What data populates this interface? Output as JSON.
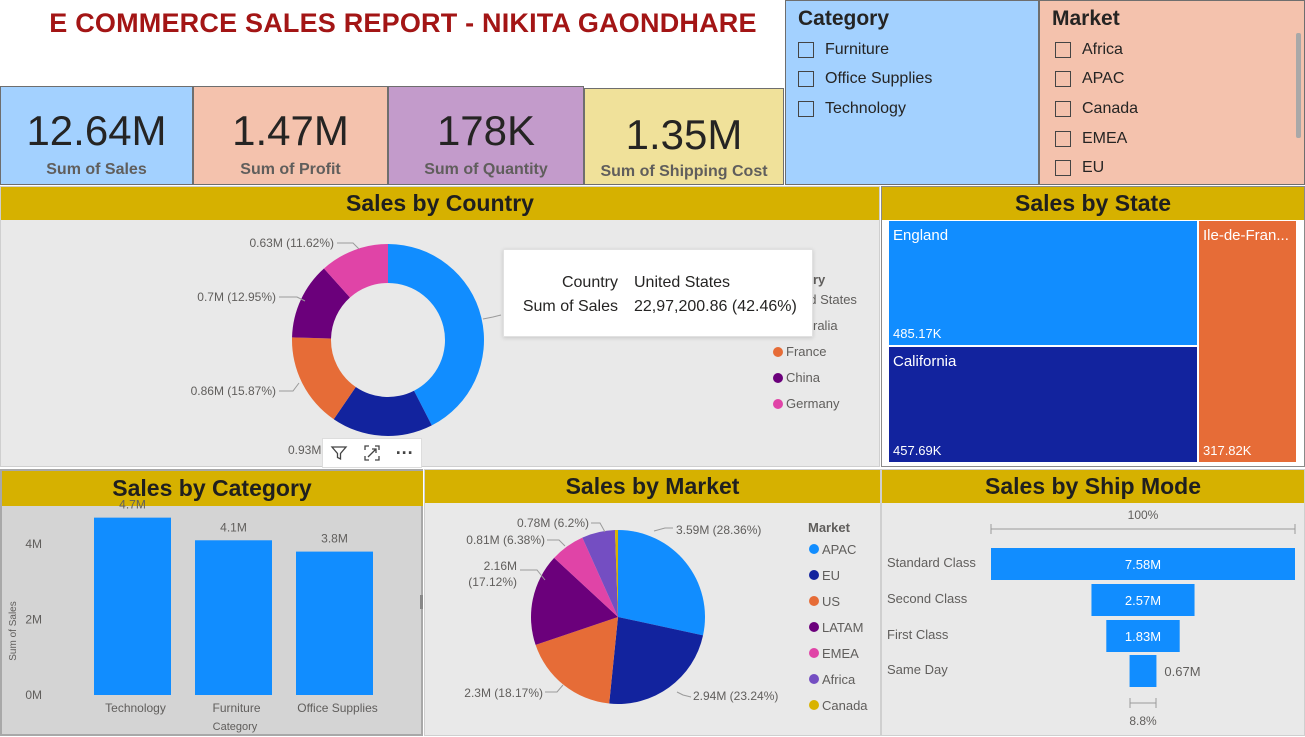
{
  "title": "E COMMERCE SALES REPORT - NIKITA GAONDHARE",
  "kpis": [
    {
      "value": "12.64M",
      "label": "Sum of Sales",
      "color": "#a3d1ff"
    },
    {
      "value": "1.47M",
      "label": "Sum of Profit",
      "color": "#f4c2ad"
    },
    {
      "value": "178K",
      "label": "Sum of Quantity",
      "color": "#c39bcb"
    },
    {
      "value": "1.35M",
      "label": "Sum of Shipping Cost",
      "color": "#f0e19a"
    }
  ],
  "category_slicer": {
    "header": "Category",
    "items": [
      "Furniture",
      "Office Supplies",
      "Technology"
    ],
    "color": "#a3d1ff"
  },
  "market_slicer": {
    "header": "Market",
    "items": [
      "Africa",
      "APAC",
      "Canada",
      "EMEA",
      "EU"
    ],
    "color": "#f4c2ad"
  },
  "sales_by_country": {
    "title": "Sales by Country",
    "legend_title": "ry",
    "legend": [
      "ed States",
      "ralia",
      "France",
      "China",
      "Germany"
    ],
    "legend_colors": [
      "#118dff",
      "#12239e",
      "#e66c37",
      "#6b007b",
      "#e044a7"
    ],
    "labels": [
      "0.63M (11.62%)",
      "0.7M (12.95%)",
      "0.86M (15.87%)",
      "0.93M"
    ],
    "tooltip": {
      "k1": "Country",
      "v1": "United States",
      "k2": "Sum of Sales",
      "v2": "22,97,200.86 (42.46%)"
    },
    "toolbar": {
      "filter": "filter-icon",
      "focus": "focus-mode-icon",
      "more": "···"
    }
  },
  "sales_by_state": {
    "title": "Sales by State",
    "cells": [
      {
        "name": "England",
        "value": "485.17K",
        "color": "#118dff"
      },
      {
        "name": "California",
        "value": "457.69K",
        "color": "#12239e"
      },
      {
        "name": "Ile-de-Fran...",
        "value": "317.82K",
        "color": "#e66c37"
      }
    ]
  },
  "chart_data": [
    {
      "type": "pie",
      "title": "Sales by Country",
      "categories": [
        "United States",
        "Australia",
        "France",
        "China",
        "Germany"
      ],
      "values": [
        2.3,
        0.93,
        0.86,
        0.7,
        0.63
      ],
      "percent": [
        42.46,
        17.1,
        15.87,
        12.95,
        11.62
      ],
      "colors": [
        "#118dff",
        "#12239e",
        "#e66c37",
        "#6b007b",
        "#e044a7"
      ]
    },
    {
      "type": "bar",
      "title": "Sales by Category",
      "categories": [
        "Technology",
        "Furniture",
        "Office Supplies"
      ],
      "values": [
        4.7,
        4.1,
        3.8
      ],
      "data_labels": [
        "4.7M",
        "4.1M",
        "3.8M"
      ],
      "xlabel": "Category",
      "ylabel": "Sum of Sales",
      "yticks": [
        "0M",
        "2M",
        "4M"
      ],
      "ylim": [
        0,
        5.3
      ],
      "color": "#118dff"
    },
    {
      "type": "pie",
      "title": "Sales by Market",
      "legend_title": "Market",
      "categories": [
        "APAC",
        "EU",
        "US",
        "LATAM",
        "EMEA",
        "Africa",
        "Canada"
      ],
      "values": [
        3.59,
        2.94,
        2.3,
        2.16,
        0.81,
        0.78,
        0.07
      ],
      "percent": [
        28.36,
        23.24,
        18.17,
        17.12,
        6.38,
        6.2,
        0.53
      ],
      "labels": [
        "3.59M (28.36%)",
        "2.94M (23.24%)",
        "2.3M (18.17%)",
        "2.16M\n(17.12%)",
        "0.81M (6.38%)",
        "0.78M (6.2%)",
        ""
      ],
      "colors": [
        "#118dff",
        "#12239e",
        "#e66c37",
        "#6b007b",
        "#e044a7",
        "#744ec2",
        "#d9b300"
      ]
    },
    {
      "type": "bar",
      "title": "Sales by Ship Mode",
      "categories": [
        "Standard Class",
        "Second Class",
        "First Class",
        "Same Day"
      ],
      "values": [
        7.58,
        2.57,
        1.83,
        0.67
      ],
      "data_labels": [
        "7.58M",
        "2.57M",
        "1.83M",
        "0.67M"
      ],
      "top_label": "100%",
      "bottom_label": "8.8%",
      "color": "#118dff"
    }
  ]
}
